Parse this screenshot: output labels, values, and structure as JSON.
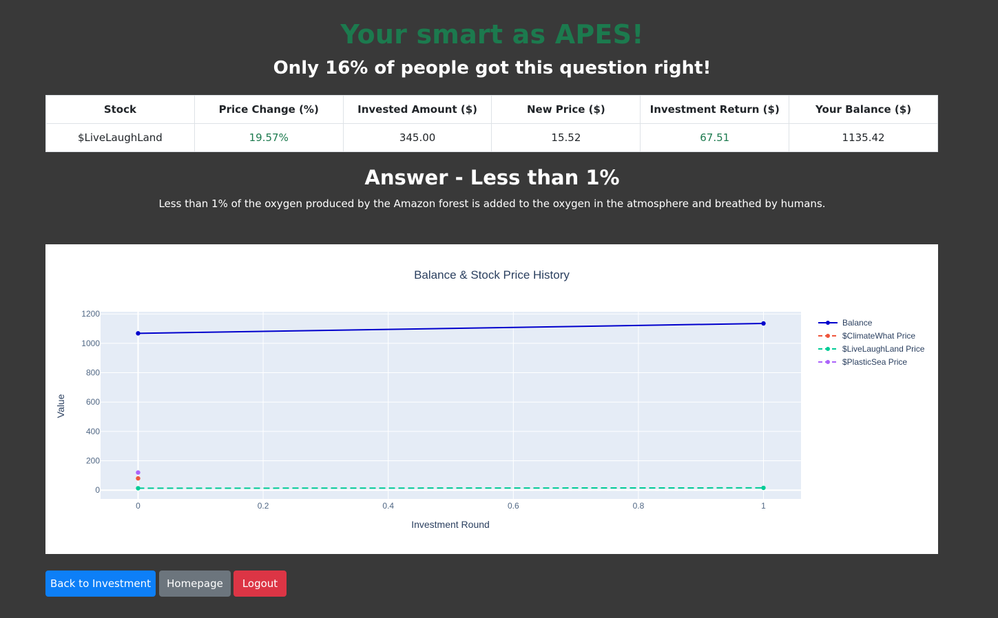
{
  "header": {
    "headline": "Your smart as APES!",
    "subhead": "Only 16% of people got this question right!",
    "headline_color": "#1c7a4e"
  },
  "results_table": {
    "columns": [
      "Stock",
      "Price Change (%)",
      "Invested Amount ($)",
      "New Price ($)",
      "Investment Return ($)",
      "Your Balance ($)"
    ],
    "row": [
      "$LiveLaughLand",
      "19.57%",
      "345.00",
      "15.52",
      "67.51",
      "1135.42"
    ]
  },
  "answer": {
    "title": "Answer - Less than 1%",
    "text": "Less than 1% of the oxygen produced by the Amazon forest is added to the oxygen in the atmosphere and breathed by humans."
  },
  "chart_data": {
    "type": "line",
    "title": "Balance & Stock Price History",
    "xlabel": "Investment Round",
    "ylabel": "Value",
    "xlim": [
      -0.06,
      1.06
    ],
    "ylim": [
      -60,
      1215
    ],
    "x_ticks": [
      0,
      0.2,
      0.4,
      0.6,
      0.8,
      1
    ],
    "x_tick_labels": [
      "0",
      "0.2",
      "0.4",
      "0.6",
      "0.8",
      "1"
    ],
    "y_ticks": [
      0,
      200,
      400,
      600,
      800,
      1000,
      1200
    ],
    "y_tick_labels": [
      "0",
      "200",
      "400",
      "600",
      "800",
      "1000",
      "1200"
    ],
    "grid": true,
    "legend_position": "right",
    "series": [
      {
        "name": "Balance",
        "x": [
          0,
          1
        ],
        "y": [
          1067.91,
          1135.42
        ],
        "color": "#0000cc",
        "dash": "solid"
      },
      {
        "name": "$ClimateWhat Price",
        "x": [
          0
        ],
        "y": [
          80
        ],
        "color": "#ef553b",
        "dash": "dash"
      },
      {
        "name": "$LiveLaughLand Price",
        "x": [
          0,
          1
        ],
        "y": [
          12.98,
          15.52
        ],
        "color": "#00cc96",
        "dash": "dash"
      },
      {
        "name": "$PlasticSea Price",
        "x": [
          0
        ],
        "y": [
          120
        ],
        "color": "#ab63fa",
        "dash": "dash"
      }
    ]
  },
  "buttons": {
    "back": "Back to Investment",
    "home": "Homepage",
    "logout": "Logout"
  }
}
